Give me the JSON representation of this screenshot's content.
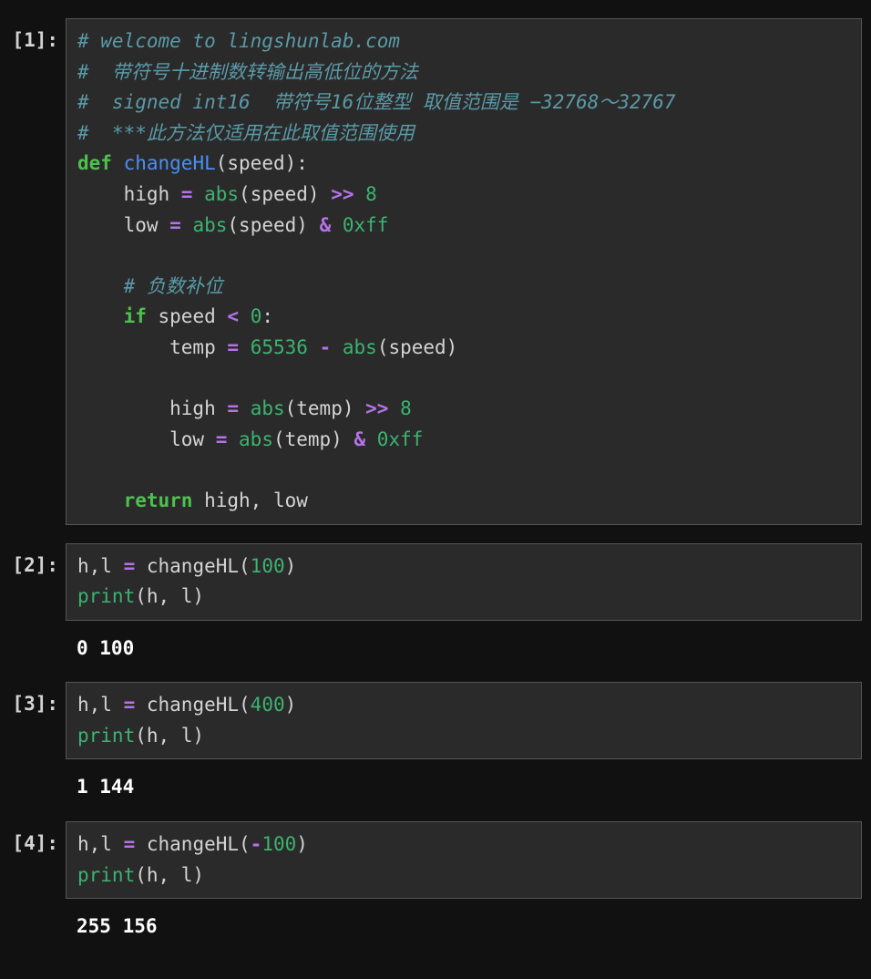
{
  "cells": [
    {
      "prompt": "[1]:",
      "code_lines": [
        [
          {
            "t": "# welcome to lingshunlab.com",
            "c": "comment"
          }
        ],
        [
          {
            "t": "#  带符号十进制数转输出高低位的方法",
            "c": "comment"
          }
        ],
        [
          {
            "t": "#  signed int16  带符号16位整型 取值范围是 −32768～32767",
            "c": "comment"
          }
        ],
        [
          {
            "t": "#  ***此方法仅适用在此取值范围使用",
            "c": "comment"
          }
        ],
        [
          {
            "t": "def",
            "c": "keyword"
          },
          {
            "t": " ",
            "c": "var"
          },
          {
            "t": "changeHL",
            "c": "funcname"
          },
          {
            "t": "(speed):",
            "c": "var"
          }
        ],
        [
          {
            "t": "    high ",
            "c": "var"
          },
          {
            "t": "=",
            "c": "operator"
          },
          {
            "t": " ",
            "c": "var"
          },
          {
            "t": "abs",
            "c": "builtin"
          },
          {
            "t": "(speed) ",
            "c": "var"
          },
          {
            "t": ">>",
            "c": "operator"
          },
          {
            "t": " ",
            "c": "var"
          },
          {
            "t": "8",
            "c": "number-lit"
          }
        ],
        [
          {
            "t": "    low ",
            "c": "var"
          },
          {
            "t": "=",
            "c": "operator"
          },
          {
            "t": " ",
            "c": "var"
          },
          {
            "t": "abs",
            "c": "builtin"
          },
          {
            "t": "(speed) ",
            "c": "var"
          },
          {
            "t": "&",
            "c": "operator"
          },
          {
            "t": " ",
            "c": "var"
          },
          {
            "t": "0xff",
            "c": "number-lit"
          }
        ],
        [
          {
            "t": "    ",
            "c": "var"
          }
        ],
        [
          {
            "t": "    ",
            "c": "var"
          },
          {
            "t": "# 负数补位",
            "c": "comment"
          }
        ],
        [
          {
            "t": "    ",
            "c": "var"
          },
          {
            "t": "if",
            "c": "keyword"
          },
          {
            "t": " speed ",
            "c": "var"
          },
          {
            "t": "<",
            "c": "operator"
          },
          {
            "t": " ",
            "c": "var"
          },
          {
            "t": "0",
            "c": "number-lit"
          },
          {
            "t": ":",
            "c": "var"
          }
        ],
        [
          {
            "t": "        temp ",
            "c": "var"
          },
          {
            "t": "=",
            "c": "operator"
          },
          {
            "t": " ",
            "c": "var"
          },
          {
            "t": "65536",
            "c": "number-lit"
          },
          {
            "t": " ",
            "c": "var"
          },
          {
            "t": "-",
            "c": "operator"
          },
          {
            "t": " ",
            "c": "var"
          },
          {
            "t": "abs",
            "c": "builtin"
          },
          {
            "t": "(speed)",
            "c": "var"
          }
        ],
        [
          {
            "t": "        ",
            "c": "var"
          }
        ],
        [
          {
            "t": "        high ",
            "c": "var"
          },
          {
            "t": "=",
            "c": "operator"
          },
          {
            "t": " ",
            "c": "var"
          },
          {
            "t": "abs",
            "c": "builtin"
          },
          {
            "t": "(temp) ",
            "c": "var"
          },
          {
            "t": ">>",
            "c": "operator"
          },
          {
            "t": " ",
            "c": "var"
          },
          {
            "t": "8",
            "c": "number-lit"
          }
        ],
        [
          {
            "t": "        low ",
            "c": "var"
          },
          {
            "t": "=",
            "c": "operator"
          },
          {
            "t": " ",
            "c": "var"
          },
          {
            "t": "abs",
            "c": "builtin"
          },
          {
            "t": "(temp) ",
            "c": "var"
          },
          {
            "t": "&",
            "c": "operator"
          },
          {
            "t": " ",
            "c": "var"
          },
          {
            "t": "0xff",
            "c": "number-lit"
          }
        ],
        [
          {
            "t": "    ",
            "c": "var"
          }
        ],
        [
          {
            "t": "    ",
            "c": "var"
          },
          {
            "t": "return",
            "c": "keyword"
          },
          {
            "t": " high, low",
            "c": "var"
          }
        ]
      ],
      "output": null
    },
    {
      "prompt": "[2]:",
      "code_lines": [
        [
          {
            "t": "h,l ",
            "c": "var"
          },
          {
            "t": "=",
            "c": "operator"
          },
          {
            "t": " changeHL(",
            "c": "var"
          },
          {
            "t": "100",
            "c": "number-lit"
          },
          {
            "t": ")",
            "c": "var"
          }
        ],
        [
          {
            "t": "print",
            "c": "builtin"
          },
          {
            "t": "(h, l)",
            "c": "var"
          }
        ]
      ],
      "output": "0 100"
    },
    {
      "prompt": "[3]:",
      "code_lines": [
        [
          {
            "t": "h,l ",
            "c": "var"
          },
          {
            "t": "=",
            "c": "operator"
          },
          {
            "t": " changeHL(",
            "c": "var"
          },
          {
            "t": "400",
            "c": "number-lit"
          },
          {
            "t": ")",
            "c": "var"
          }
        ],
        [
          {
            "t": "print",
            "c": "builtin"
          },
          {
            "t": "(h, l)",
            "c": "var"
          }
        ]
      ],
      "output": "1 144"
    },
    {
      "prompt": "[4]:",
      "code_lines": [
        [
          {
            "t": "h,l ",
            "c": "var"
          },
          {
            "t": "=",
            "c": "operator"
          },
          {
            "t": " changeHL(",
            "c": "var"
          },
          {
            "t": "-",
            "c": "operator"
          },
          {
            "t": "100",
            "c": "number-lit"
          },
          {
            "t": ")",
            "c": "var"
          }
        ],
        [
          {
            "t": "print",
            "c": "builtin"
          },
          {
            "t": "(h, l)",
            "c": "var"
          }
        ]
      ],
      "output": "255 156"
    }
  ]
}
